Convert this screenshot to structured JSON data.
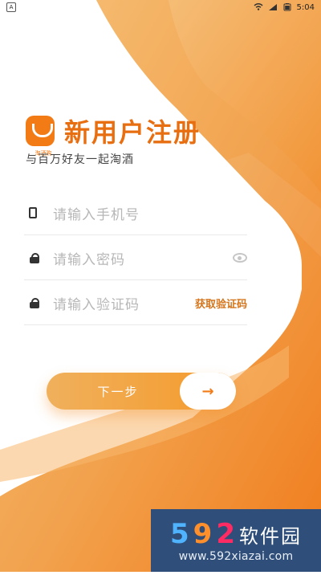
{
  "status_bar": {
    "left_icon": "A",
    "time": "5:04"
  },
  "header": {
    "logo_text": "淘酒购",
    "title": "新用户注册",
    "subtitle": "与百万好友一起淘酒"
  },
  "form": {
    "phone": {
      "placeholder": "请输入手机号"
    },
    "password": {
      "placeholder": "请输入密码"
    },
    "code": {
      "placeholder": "请输入验证码",
      "action_label": "获取验证码"
    }
  },
  "actions": {
    "next_label": "下一步",
    "next_arrow": "→"
  },
  "watermark": {
    "digit1": "5",
    "digit2": "9",
    "digit3": "2",
    "cn": "软件园",
    "url": "www.592xiazai.com"
  },
  "colors": {
    "primary": "#f27b16",
    "gradient_start": "#f6c27a",
    "gradient_end": "#f07c1c"
  }
}
